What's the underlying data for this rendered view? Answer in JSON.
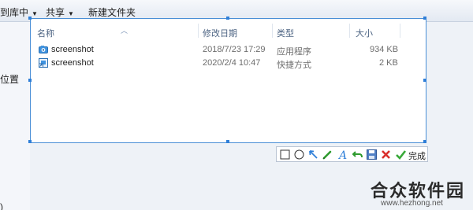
{
  "toolbar": {
    "include_in_library": "到库中",
    "share": "共享",
    "new_folder": "新建文件夹"
  },
  "left_pane": {
    "label_location": "位置",
    "label_bottom": ")"
  },
  "columns": {
    "name": "名称",
    "modified": "修改日期",
    "type": "类型",
    "size": "大小"
  },
  "files": [
    {
      "name": "screenshot",
      "modified": "2018/7/23 17:29",
      "type": "应用程序",
      "size": "934 KB",
      "icon": "app-camera-icon"
    },
    {
      "name": "screenshot",
      "modified": "2020/2/4 10:47",
      "type": "快捷方式",
      "size": "2 KB",
      "icon": "shortcut-icon"
    }
  ],
  "capture_toolbar": {
    "tools": [
      "rectangle-icon",
      "ellipse-icon",
      "arrow-icon",
      "pen-icon",
      "text-icon",
      "undo-icon",
      "save-icon",
      "cancel-icon",
      "confirm-icon"
    ],
    "done_label": "完成"
  },
  "watermark": {
    "title": "合众软件园",
    "url": "www.hezhong.net"
  },
  "colors": {
    "selection_border": "#4a8fd6",
    "accent_blue": "#2f7fd8",
    "pen_green": "#2e9b2e",
    "cancel_red": "#d9302c",
    "confirm_green": "#39a939"
  }
}
